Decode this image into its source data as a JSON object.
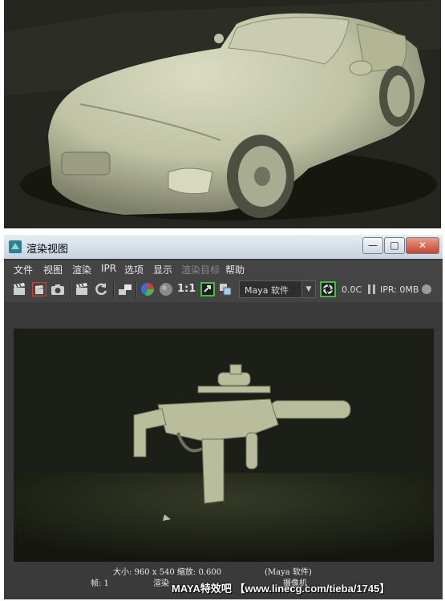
{
  "window": {
    "title": "渲染视图",
    "minimize": "—",
    "maximize": "□",
    "close": "✕"
  },
  "menu": [
    "文件",
    "视图",
    "渲染",
    "IPR",
    "选项",
    "显示",
    "渲染目标",
    "帮助"
  ],
  "toolbar": {
    "ratio_label": "1:1",
    "renderer_value": "Maya 软件",
    "render_time": "0.0C",
    "ipr_memory": "IPR: 0MB",
    "icons": [
      "clapper-icon",
      "clapper-region-icon",
      "snapshot-icon",
      "ipr-clapper-icon",
      "refresh-icon",
      "render-sequence-icon",
      "rgb-channel-icon",
      "alpha-channel-icon",
      "real-size-icon",
      "keep-image-icon",
      "remove-image-icon",
      "render-settings-icon",
      "pause-icon",
      "ipr-status-icon"
    ]
  },
  "status": {
    "line1": "大小: 960 x 540 缩放: 0.600",
    "renderer": "(Maya 软件)",
    "frame": "帧: 1",
    "line2_left": "渲染",
    "line2_mid": "摄像机"
  },
  "watermark": "MAYA特效吧 【www.linecg.com/tieba/1745】",
  "colors": {
    "ui_dark": "#444444",
    "viewport_bg": "#1c1f17",
    "model_color": "#b9bd9c",
    "highlight_border": "#d43a2a",
    "active_green": "#3fbf3f"
  }
}
